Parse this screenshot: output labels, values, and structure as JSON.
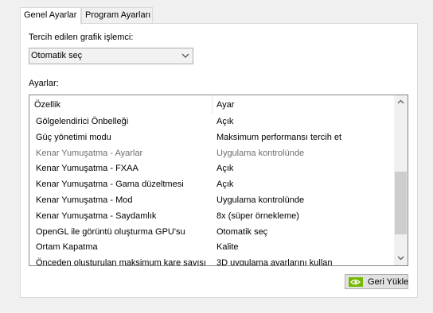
{
  "tabs": [
    {
      "label": "Genel Ayarlar",
      "active": true
    },
    {
      "label": "Program Ayarları",
      "active": false
    }
  ],
  "graphics_processor": {
    "label": "Tercih edilen grafik işlemci:",
    "selected": "Otomatik seç"
  },
  "settings": {
    "label": "Ayarlar:",
    "columns": [
      "Özellik",
      "Ayar"
    ],
    "rows": [
      {
        "feature": "Gölgelendirici Önbelleği",
        "value": "Açık",
        "disabled": false
      },
      {
        "feature": "Güç yönetimi modu",
        "value": "Maksimum performansı tercih et",
        "disabled": false
      },
      {
        "feature": "Kenar Yumuşatma - Ayarlar",
        "value": "Uygulama kontrolünde",
        "disabled": true
      },
      {
        "feature": "Kenar Yumuşatma - FXAA",
        "value": "Açık",
        "disabled": false
      },
      {
        "feature": "Kenar Yumuşatma - Gama düzeltmesi",
        "value": "Açık",
        "disabled": false
      },
      {
        "feature": "Kenar Yumuşatma - Mod",
        "value": "Uygulama kontrolünde",
        "disabled": false
      },
      {
        "feature": "Kenar Yumuşatma - Saydamlık",
        "value": "8x (süper örnekleme)",
        "disabled": false
      },
      {
        "feature": "OpenGL ile görüntü oluşturma GPU'su",
        "value": "Otomatik seç",
        "disabled": false
      },
      {
        "feature": "Ortam Kapatma",
        "value": "Kalite",
        "disabled": false
      },
      {
        "feature": "Önceden oluşturulan maksimum kare sayısı",
        "value": "3D uygulama ayarlarını kullan",
        "disabled": false
      }
    ]
  },
  "restore_button": {
    "label": "Geri Yükle",
    "icon": "nvidia-logo-icon"
  },
  "colors": {
    "accent_green": "#76b900"
  }
}
